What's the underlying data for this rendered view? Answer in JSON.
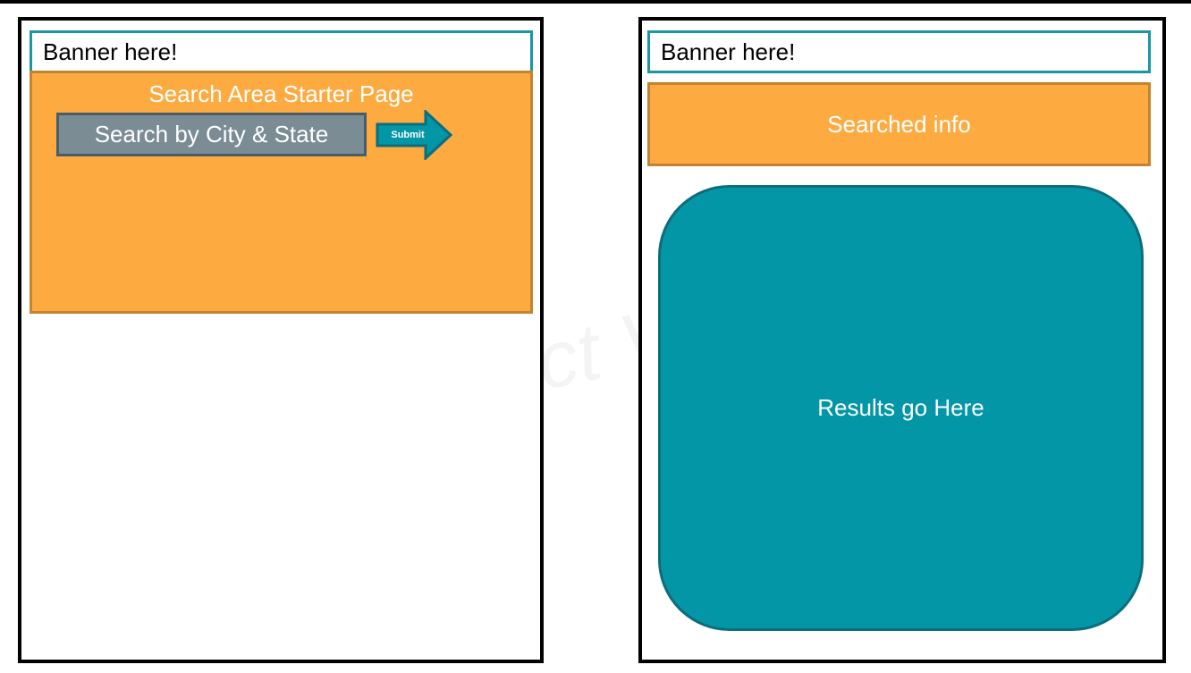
{
  "left_panel": {
    "banner_text": "Banner here!",
    "search_area": {
      "title": "Search Area Starter Page",
      "search_field_label": "Search by City & State",
      "submit_label": "Submit"
    }
  },
  "right_panel": {
    "banner_text": "Banner here!",
    "searched_info_label": "Searched info",
    "results_label": "Results go Here"
  },
  "watermark_text": "ct V",
  "colors": {
    "banner_border": "#1a97a3",
    "orange_fill": "#fdab41",
    "orange_border": "#c48331",
    "search_field_fill": "#7b8c95",
    "search_field_border": "#485d69",
    "teal_fill": "#0396a6",
    "teal_border": "#0c6d7d"
  },
  "icons": {
    "submit": "arrow-right-icon"
  }
}
